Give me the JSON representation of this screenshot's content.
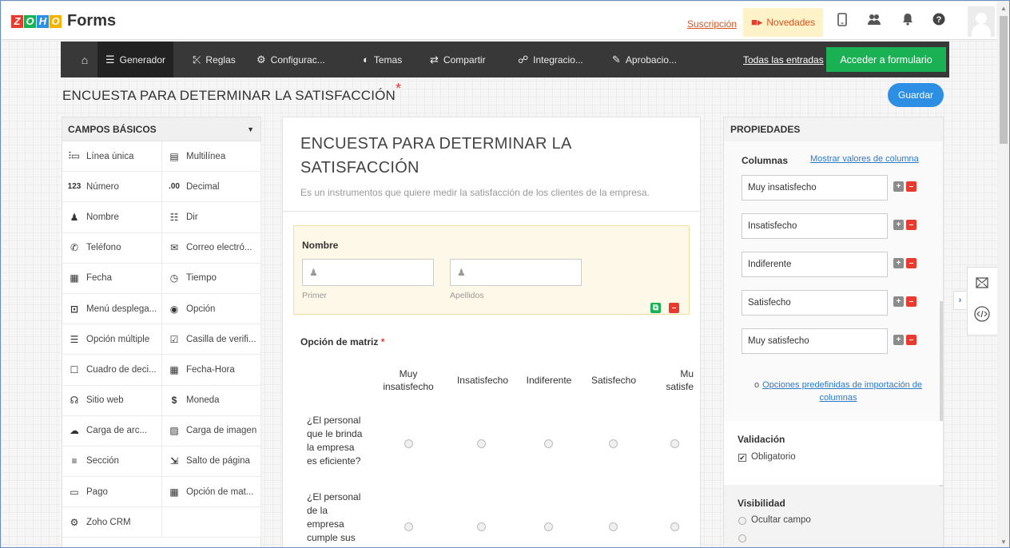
{
  "app": {
    "logo_letters": [
      "Z",
      "O",
      "H",
      "O"
    ],
    "logo_colors": [
      "#e63b2e",
      "#1ab154",
      "#2d8fe4",
      "#f5b300"
    ],
    "name": "Forms"
  },
  "topbar": {
    "subscription_link": "Suscripción",
    "news_label": "Novedades",
    "icons": [
      "mobile-icon",
      "people-icon",
      "bell-icon",
      "help-icon"
    ]
  },
  "nav": {
    "home_icon": "home-icon",
    "items": [
      {
        "label": "Generador",
        "icon": "builder-icon"
      },
      {
        "label": "Reglas",
        "icon": "shuffle-icon"
      },
      {
        "label": "Configurac...",
        "icon": "settings-icon"
      },
      {
        "label": "Temas",
        "icon": "palette-icon"
      },
      {
        "label": "Compartir",
        "icon": "share-icon"
      },
      {
        "label": "Integracio...",
        "icon": "integration-icon"
      },
      {
        "label": "Aprobacio...",
        "icon": "approval-icon"
      }
    ],
    "all_entries": "Todas las entradas",
    "access_form": "Acceder a formulario"
  },
  "form": {
    "title": "ENCUESTA PARA DETERMINAR LA SATISFACCIÓN",
    "title_star": "*",
    "save": "Guardar",
    "heading": "ENCUESTA PARA DETERMINAR LA SATISFACCIÓN",
    "description": "Es un instrumentos que quiere medir la satisfacción de los clientes de la empresa."
  },
  "left_panel": {
    "title": "CAMPOS BÁSICOS",
    "fields": [
      {
        "label": "Línea única",
        "icon": "single-line-icon",
        "glyph": "⫶▭"
      },
      {
        "label": "Multilínea",
        "icon": "multi-line-icon",
        "glyph": "▤"
      },
      {
        "label": "Número",
        "icon": "number-icon",
        "glyph": "123"
      },
      {
        "label": "Decimal",
        "icon": "decimal-icon",
        "glyph": ".00"
      },
      {
        "label": "Nombre",
        "icon": "name-icon",
        "glyph": "♟"
      },
      {
        "label": "Dir",
        "icon": "address-icon",
        "glyph": "☷"
      },
      {
        "label": "Teléfono",
        "icon": "phone-icon",
        "glyph": "✆"
      },
      {
        "label": "Correo electró...",
        "icon": "email-icon",
        "glyph": "✉"
      },
      {
        "label": "Fecha",
        "icon": "date-icon",
        "glyph": "▦"
      },
      {
        "label": "Tiempo",
        "icon": "time-icon",
        "glyph": "◷"
      },
      {
        "label": "Menú desplega...",
        "icon": "dropdown-icon",
        "glyph": "⊡"
      },
      {
        "label": "Opción",
        "icon": "radio-icon",
        "glyph": "◉"
      },
      {
        "label": "Opción múltiple",
        "icon": "multiple-choice-icon",
        "glyph": "☰"
      },
      {
        "label": "Casilla de verifi...",
        "icon": "checkbox-icon",
        "glyph": "☑"
      },
      {
        "label": "Cuadro de deci...",
        "icon": "decision-box-icon",
        "glyph": "☐"
      },
      {
        "label": "Fecha-Hora",
        "icon": "datetime-icon",
        "glyph": "▦"
      },
      {
        "label": "Sitio web",
        "icon": "website-icon",
        "glyph": "☊"
      },
      {
        "label": "Moneda",
        "icon": "currency-icon",
        "glyph": "$"
      },
      {
        "label": "Carga de arc...",
        "icon": "file-upload-icon",
        "glyph": "☁"
      },
      {
        "label": "Carga de imagen",
        "icon": "image-upload-icon",
        "glyph": "▨"
      },
      {
        "label": "Sección",
        "icon": "section-icon",
        "glyph": "≡"
      },
      {
        "label": "Salto de página",
        "icon": "page-break-icon",
        "glyph": "⇲"
      },
      {
        "label": "Pago",
        "icon": "payment-icon",
        "glyph": "▭"
      },
      {
        "label": "Opción de mat...",
        "icon": "matrix-icon",
        "glyph": "▦"
      },
      {
        "label": "Zoho CRM",
        "icon": "crm-icon",
        "glyph": "⚙"
      },
      {
        "label": "",
        "icon": "",
        "glyph": ""
      }
    ]
  },
  "name_field": {
    "label": "Nombre",
    "first_sub": "Primer",
    "last_sub": "Apellidos"
  },
  "matrix": {
    "label": "Opción de matriz",
    "required_star": "*",
    "columns": [
      {
        "line1": "Muy",
        "line2": "insatisfecho"
      },
      {
        "line1": "Insatisfecho",
        "line2": ""
      },
      {
        "line1": "Indiferente",
        "line2": ""
      },
      {
        "line1": "Satisfecho",
        "line2": ""
      },
      {
        "line1": "Mu",
        "line2": "satisfe"
      }
    ],
    "rows": [
      [
        "¿El personal",
        "que le brinda",
        "la empresa",
        "es eficiente?"
      ],
      [
        "¿El personal",
        "de la",
        "empresa",
        "cumple sus"
      ]
    ]
  },
  "properties": {
    "title": "PROPIEDADES",
    "columns_label": "Columnas",
    "show_values_link": "Mostrar valores de columna",
    "column_values": [
      "Muy insatisfecho",
      "Insatisfecho",
      "Indiferente",
      "Satisfecho",
      "Muy satisfecho"
    ],
    "import_bullet": "o",
    "import_link_line1": "Opciones predefinidas de importación de",
    "import_link_line2": "columnas",
    "validation_title": "Validación",
    "required_label": "Obligatorio",
    "required_checked": true,
    "visibility_title": "Visibilidad",
    "hide_field": "Ocultar campo"
  }
}
